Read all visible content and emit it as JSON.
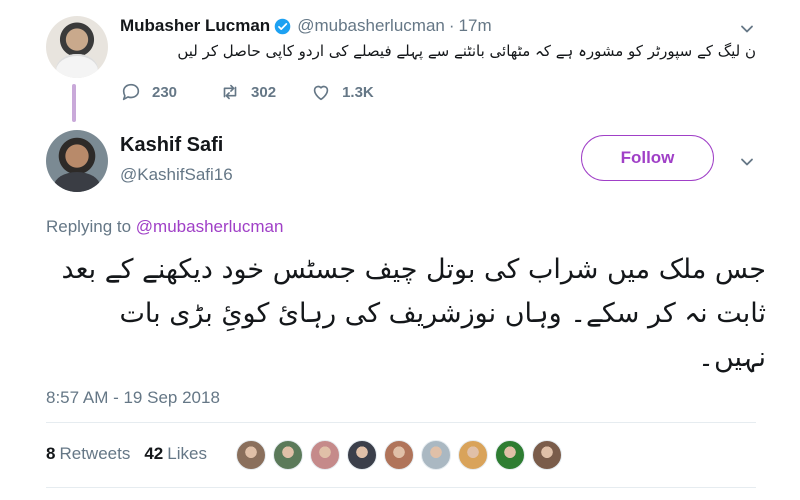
{
  "parent_tweet": {
    "name": "Mubasher Lucman",
    "handle": "@mubasherlucman",
    "separator": "·",
    "time": "17m",
    "text": "ن لیگ کے سپورٹر کو مشورہ ہے کہ مٹھائی بانٹنے سے پہلے فیصلے کی اردو کاپی حاصل کر لیں",
    "replies": "230",
    "retweets": "302",
    "likes": "1.3K"
  },
  "main_tweet": {
    "name": "Kashif Safi",
    "handle": "@KashifSafi16",
    "follow_label": "Follow",
    "replying_prefix": "Replying to",
    "replying_to": "@mubasherlucman",
    "text": "جس ملک میں شراب کی بوتل چیف جسٹس خود دیکھنے کے بعد ثابت نہ کر سکے۔ وہاں نوزشریف کی رہائ کوئِ بڑی بات نہیں۔",
    "timestamp": "8:57 AM - 19 Sep 2018",
    "retweets_count": "8",
    "retweets_label": "Retweets",
    "likes_count": "42",
    "likes_label": "Likes"
  },
  "liker_avatars": [
    {
      "icon": "liker-avatar-1",
      "color": "#8a6f5c"
    },
    {
      "icon": "liker-avatar-2",
      "color": "#5b7a5a"
    },
    {
      "icon": "liker-avatar-3",
      "color": "#c58a8a"
    },
    {
      "icon": "liker-avatar-4",
      "color": "#3b3f4a"
    },
    {
      "icon": "liker-avatar-5",
      "color": "#b0745a"
    },
    {
      "icon": "liker-avatar-6",
      "color": "#aab8c2"
    },
    {
      "icon": "liker-avatar-7",
      "color": "#d9a35a"
    },
    {
      "icon": "liker-avatar-8",
      "color": "#2e7d32"
    },
    {
      "icon": "liker-avatar-9",
      "color": "#7a5c4a"
    }
  ],
  "colors": {
    "accent": "#a040c7",
    "muted": "#657786",
    "text": "#14171a",
    "verified": "#1da1f2"
  }
}
